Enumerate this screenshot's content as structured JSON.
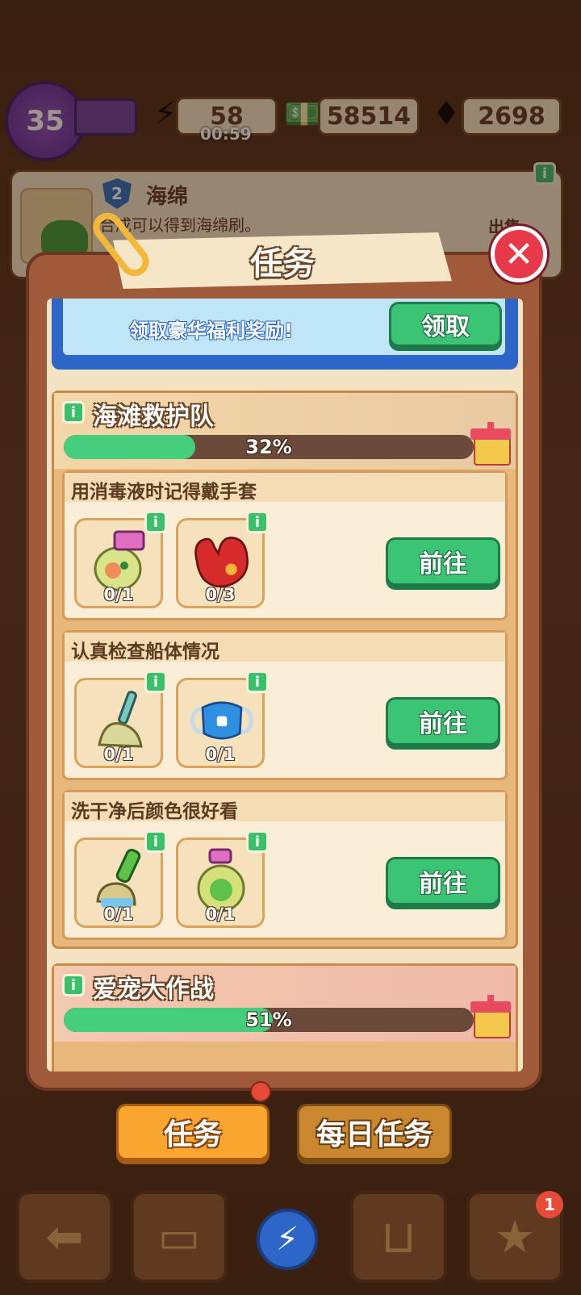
{
  "hud": {
    "level": "35",
    "energy": "58",
    "energy_timer": "00:59",
    "cash": "58514",
    "gems": "2698"
  },
  "info_card": {
    "item_level": "2",
    "item_name": "海绵",
    "description": "合成可以得到海绵刷。",
    "sell_label": "出售"
  },
  "modal": {
    "title": "任务",
    "reward_text": "领取豪华福利奖励!",
    "claim_label": "领取"
  },
  "sections": [
    {
      "title": "海滩救护队",
      "progress_text": "32%",
      "progress": 0.32,
      "tasks": [
        {
          "title": "用消毒液时记得戴手套",
          "go_label": "前往",
          "items": [
            {
              "icon": "disinfectant-bottle-icon",
              "count": "0/1"
            },
            {
              "icon": "red-gloves-icon",
              "count": "0/3"
            }
          ]
        },
        {
          "title": "认真检查船体情况",
          "go_label": "前往",
          "items": [
            {
              "icon": "mop-icon",
              "count": "0/1"
            },
            {
              "icon": "face-mask-icon",
              "count": "0/1"
            }
          ]
        },
        {
          "title": "洗干净后颜色很好看",
          "go_label": "前往",
          "items": [
            {
              "icon": "green-brush-icon",
              "count": "0/1"
            },
            {
              "icon": "detergent-bottle-icon",
              "count": "0/1"
            }
          ]
        }
      ]
    },
    {
      "title": "爱宠大作战",
      "progress_text": "51%",
      "progress": 0.51
    }
  ],
  "tabs": {
    "tasks": "任务",
    "daily_tasks": "每日任务"
  },
  "nav": {
    "badge": "1"
  },
  "colors": {
    "accent_green": "#3cc475",
    "progress_green": "#45cf7d",
    "tab_orange": "#f9a630",
    "close_red": "#e8394a"
  }
}
